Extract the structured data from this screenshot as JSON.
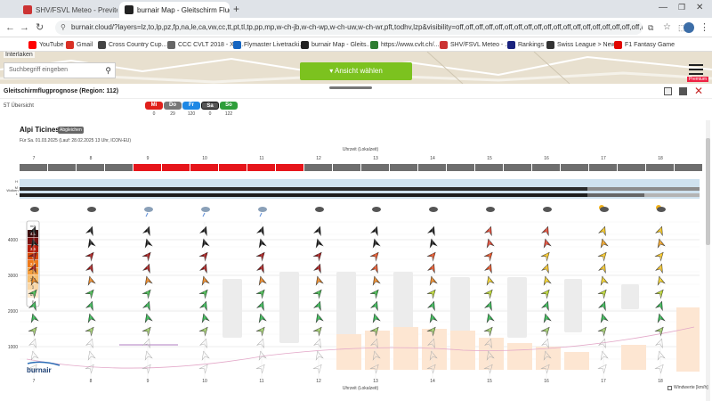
{
  "browser": {
    "tabs": [
      {
        "label": "SHV/FSVL Meteo - Previtemps s",
        "active": false,
        "color": "#cc3333"
      },
      {
        "label": "burnair Map - Gleitschirm Flug",
        "active": true,
        "color": "#222222"
      }
    ],
    "new_tab": "+",
    "url": "burnair.cloud/?layers=lz,to,lp,pz,fp,na,le,ca,vw,cc,tt,pt,tl,tp,pp,mp,w-ch-jb,w-ch-wp,w-ch-uw,w-ch-wr,pft,todhv,lzp&visibility=off,off,off,off,off,off,off,off,off,off,off,off,off,off,off,off,off,off,off,auto,off..."
  },
  "bookmarks": [
    {
      "label": "YouTube",
      "color": "#ff0000"
    },
    {
      "label": "Gmail",
      "color": "#d93025"
    },
    {
      "label": "Cross Country Cup...",
      "color": "#444444"
    },
    {
      "label": "CCC CVLT 2018 - XC...",
      "color": "#666666"
    },
    {
      "label": "Flymaster Livetracki...",
      "color": "#1565c0"
    },
    {
      "label": "burnair Map - Gleits...",
      "color": "#222222"
    },
    {
      "label": "https://www.cvlt.ch/...",
      "color": "#2e7d32"
    },
    {
      "label": "SHV/FSVL Meteo - ...",
      "color": "#cc3333"
    },
    {
      "label": "Rankings",
      "color": "#1a237e"
    },
    {
      "label": "Swiss League > News",
      "color": "#333333"
    },
    {
      "label": "F1 Fantasy Game",
      "color": "#e10600"
    }
  ],
  "map": {
    "region_label": "Interlaken",
    "search_placeholder": "Suchbegriff eingeben",
    "view_button": "Ansicht wählen",
    "premium_badge": "Premium"
  },
  "panel": {
    "title": "Gleitschirmflugprognose (Region: 112)",
    "overview_label": "5T Übersicht",
    "days": [
      {
        "label": "Mi",
        "count": "0",
        "color": "#e0201b"
      },
      {
        "label": "Do",
        "count": "29",
        "color": "#777777"
      },
      {
        "label": "Fr",
        "count": "120",
        "color": "#1e88e5"
      },
      {
        "label": "Sa",
        "count": "0",
        "color": "#555555"
      },
      {
        "label": "So",
        "count": "122",
        "color": "#2e9e3a"
      }
    ]
  },
  "forecast": {
    "place": "Alpi Ticinesi",
    "compare_button": "Abgleichen",
    "subtitle": "Für Sa. 01.03.2025 (Lauf: 28.02.2025 13 Uhr, ICON-EU)",
    "time_axis_label": "Uhrzeit (Lokalzeit)",
    "hours": [
      "7",
      "8",
      "9",
      "10",
      "11",
      "12",
      "13",
      "14",
      "15",
      "16",
      "17",
      "18"
    ],
    "cloud_label": "Wolken",
    "cloud_levels": [
      "H",
      "M",
      "L"
    ],
    "altitude_ticks": [
      "4000",
      "3000",
      "2000",
      "1000"
    ],
    "speed_unit": "m/s",
    "speed_levels": [
      "4.5",
      "4",
      "3.5",
      "3",
      "2.5",
      "2",
      "1.5",
      "1",
      "0.5",
      "0"
    ],
    "wind_toggle_label": "Windwerte [km/h]",
    "logo_text": "burnair"
  }
}
